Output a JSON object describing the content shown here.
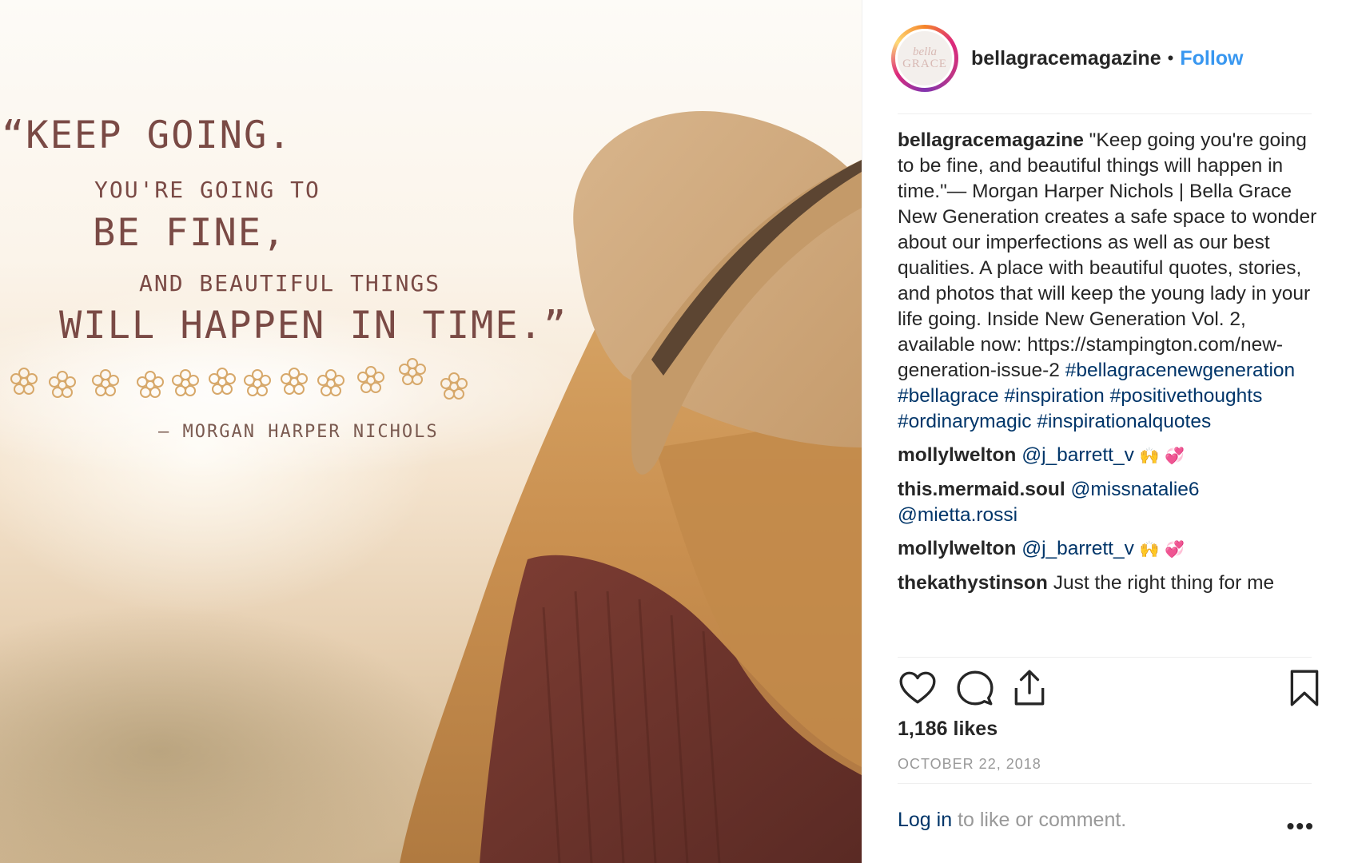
{
  "image": {
    "quote_lines": [
      "“KEEP GOING.",
      "YOU'RE GOING TO",
      "BE FINE,",
      "AND BEAUTIFUL THINGS",
      "WILL HAPPEN IN TIME.”"
    ],
    "author": "— MORGAN HARPER NICHOLS"
  },
  "post": {
    "avatar": {
      "line1": "bella",
      "line2": "GRACE"
    },
    "username": "bellagracemagazine",
    "separator": "•",
    "follow_label": "Follow",
    "caption": {
      "user": "bellagracemagazine",
      "text": "\"Keep going you're going to be fine, and beautiful things will happen in time.\"— Morgan Harper Nichols | Bella Grace New Generation creates a safe space to wonder about our imperfections as well as our best qualities. A place with beautiful quotes, stories, and photos that will keep the young lady in your life going. Inside New Generation Vol. 2, available now: https://stampington.com/new-generation-issue-2",
      "hashtags": [
        "#bellagracenewgeneration",
        "#bellagrace",
        "#inspiration",
        "#positivethoughts",
        "#ordinarymagic",
        "#inspirationalquotes"
      ]
    },
    "comments": [
      {
        "user": "mollylwelton",
        "mention": "@j_barrett_v",
        "text": "",
        "emoji": true
      },
      {
        "user": "this.mermaid.soul",
        "mention": "@missnatalie6 @mietta.rossi",
        "text": "",
        "emoji": false
      },
      {
        "user": "mollylwelton",
        "mention": "@j_barrett_v",
        "text": "",
        "emoji": true
      },
      {
        "user": "thekathystinson",
        "mention": "",
        "text": "Just the right thing for me",
        "emoji": false
      }
    ],
    "icons": {
      "like": "heart-icon",
      "comment": "comment-icon",
      "share": "share-icon",
      "save": "bookmark-icon"
    },
    "likes": "1,186 likes",
    "date": "OCTOBER 22, 2018",
    "footer": {
      "login_label": "Log in",
      "rest": " to like or comment."
    },
    "more_label": "•••",
    "colors": {
      "link_blue": "#3897f0",
      "tag_blue": "#003569",
      "quote_text": "#7a4a45"
    }
  }
}
